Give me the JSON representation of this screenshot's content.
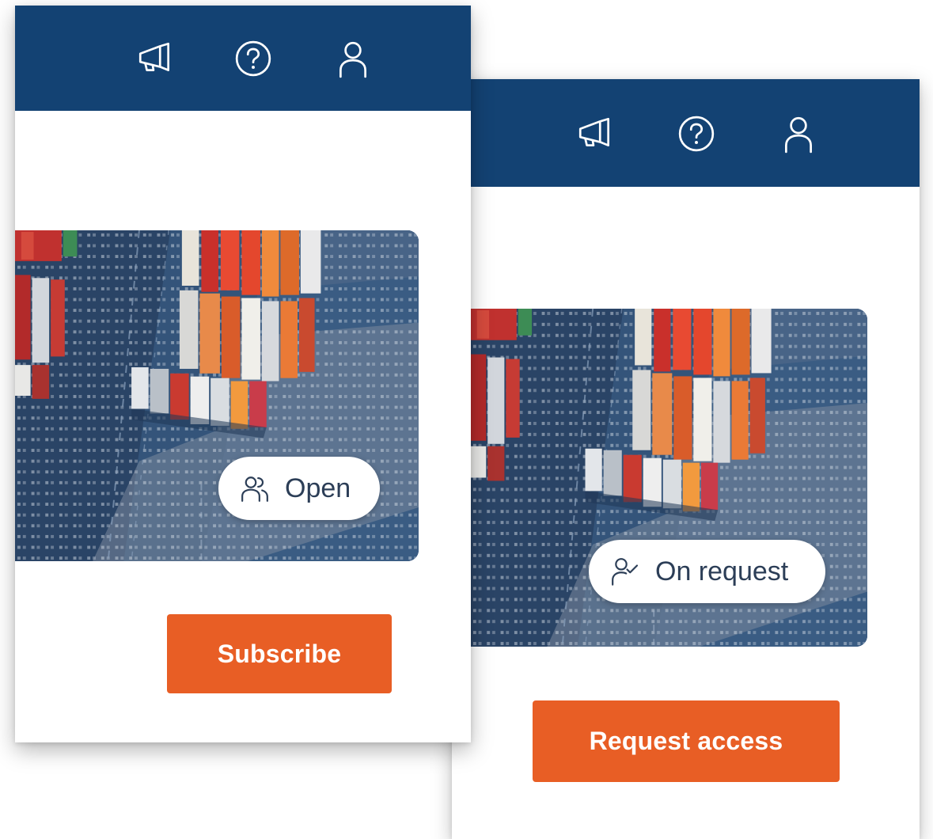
{
  "colors": {
    "topbar": "#134273",
    "accent_button": "#e85e25",
    "pill_text": "#2c3e57",
    "background": "#ffffff"
  },
  "icons": {
    "announcements": "megaphone-icon",
    "help": "question-circle-icon",
    "profile": "user-icon"
  },
  "cards": {
    "open": {
      "badge_label": "Open",
      "badge_icon": "users-icon",
      "button_label": "Subscribe"
    },
    "on_request": {
      "badge_label": "On request",
      "badge_icon": "user-check-icon",
      "button_label": "Request access"
    }
  }
}
